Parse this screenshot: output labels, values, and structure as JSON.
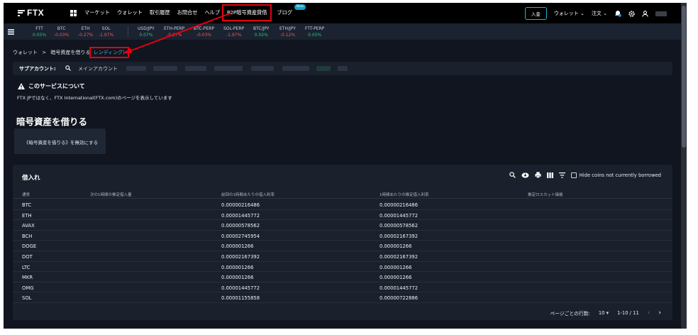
{
  "nav": {
    "logo": "FTX",
    "links": [
      "マーケット",
      "ウォレット",
      "取引履歴",
      "お問合せ",
      "ヘルプ",
      "P2P暗号資産貸借",
      "ブログ"
    ],
    "new_badge": "New",
    "deposit": "入金",
    "wallet": "ウォレット ⌄",
    "orders": "注文 ⌄"
  },
  "ticker": [
    {
      "name": "FTT",
      "change": "0.05%",
      "dir": "up"
    },
    {
      "name": "BTC",
      "change": "-0.03%",
      "dir": "dn"
    },
    {
      "name": "ETH",
      "change": "-0.27%",
      "dir": "dn"
    },
    {
      "name": "SOL",
      "change": "-1.97%",
      "dir": "dn"
    },
    {
      "name": "USD/JPY",
      "change": "0.07%",
      "dir": "up"
    },
    {
      "name": "ETH-PERP",
      "change": "-0.27%",
      "dir": "dn"
    },
    {
      "name": "BTC-PERP",
      "change": "-0.03%",
      "dir": "dn"
    },
    {
      "name": "SOL-PERP",
      "change": "-1.97%",
      "dir": "dn"
    },
    {
      "name": "BTC/JPY",
      "change": "0.02%",
      "dir": "up"
    },
    {
      "name": "ETH/JPY",
      "change": "-0.12%",
      "dir": "dn"
    },
    {
      "name": "FTT-PERP",
      "change": "0.05%",
      "dir": "up"
    }
  ],
  "breadcrumb": {
    "wallet": "ウォレット",
    "sep": ">",
    "current": "暗号資産を借りる",
    "lending": "レンディング)"
  },
  "subaccount": {
    "label": "サブアカウント:",
    "main": "メインアカウント"
  },
  "about": {
    "title": "このサービスについて",
    "desc": "FTX JPではなく、FTX International(FTX.com)のページを表示しています"
  },
  "borrow": {
    "title": "暗号資産を借りる",
    "disable_btn": "《暗号資産を借りる》を無効にする"
  },
  "table": {
    "title": "借入れ",
    "hide_label": "Hide coins not currently borrowed",
    "headers": [
      "通貨",
      "次の1時間の推定借入量",
      "前回の1時間あたりの借入利率",
      "1時間あたりの推定借入利率",
      "推定ロスカット価格"
    ],
    "rows": [
      [
        "BTC",
        "",
        "0.00000216486",
        "0.00000216486",
        ""
      ],
      [
        "ETH",
        "",
        "0.00001445772",
        "0.00001445772",
        ""
      ],
      [
        "AVAX",
        "",
        "0.00000578562",
        "0.00000578562",
        ""
      ],
      [
        "BCH",
        "",
        "0.00002745954",
        "0.00002167392",
        ""
      ],
      [
        "DOGE",
        "",
        "0.000001266",
        "0.000001266",
        ""
      ],
      [
        "DOT",
        "",
        "0.00002167392",
        "0.00002167392",
        ""
      ],
      [
        "LTC",
        "",
        "0.000001266",
        "0.000001266",
        ""
      ],
      [
        "MKR",
        "",
        "0.000001266",
        "0.000001266",
        ""
      ],
      [
        "OMG",
        "",
        "0.00001445772",
        "0.00001445772",
        ""
      ],
      [
        "SOL",
        "",
        "0.00001155858",
        "0.00000722886",
        ""
      ]
    ],
    "rows_per_page_label": "ページごとの行数:",
    "rows_per_page": "10 ▾",
    "range": "1-10 / 11"
  }
}
